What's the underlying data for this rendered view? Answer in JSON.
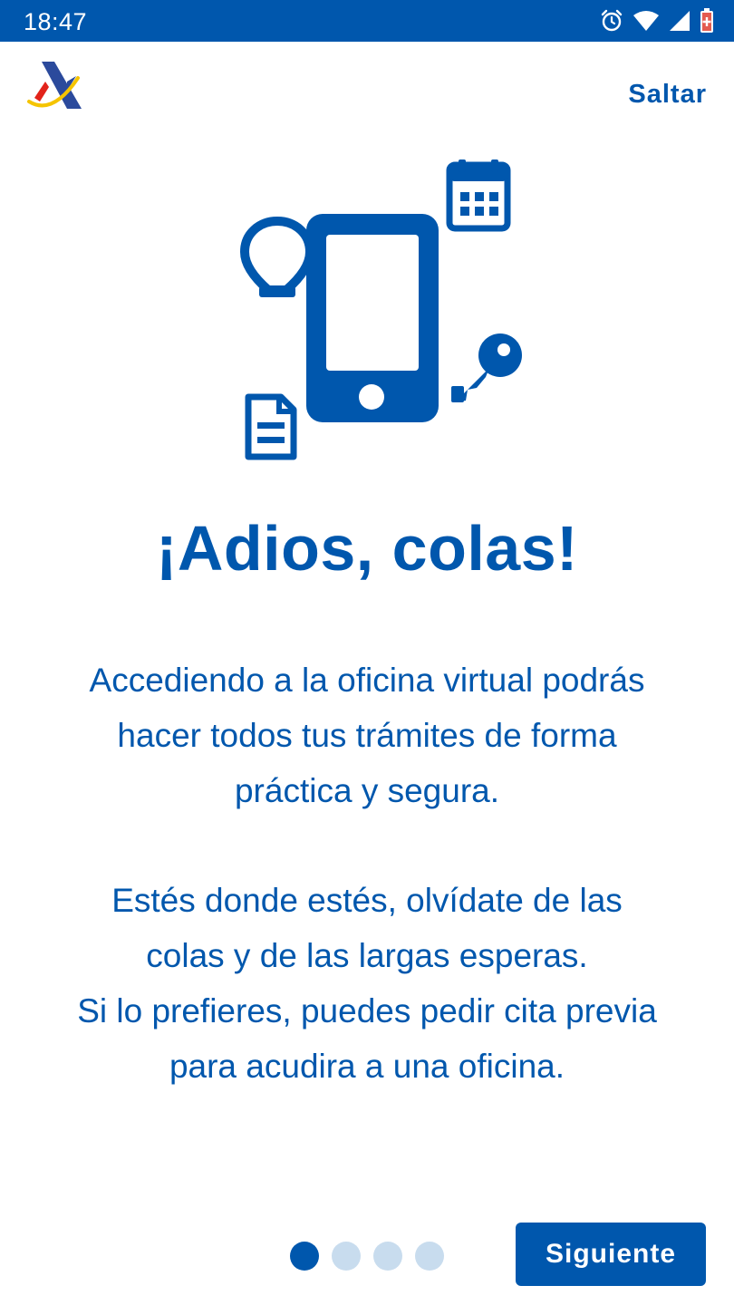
{
  "status_bar": {
    "time": "18:47",
    "icons": [
      "alarm-icon",
      "wifi-icon",
      "signal-icon",
      "battery-icon"
    ]
  },
  "header": {
    "logo": "aeat-logo",
    "skip_label": "Saltar"
  },
  "illustration": {
    "icons": [
      "phone-icon",
      "lightbulb-icon",
      "calendar-icon",
      "key-icon",
      "document-icon"
    ]
  },
  "main": {
    "title": "¡Adios, colas!",
    "paragraph1_lines": [
      "Accediendo a la oficina virtual podrás",
      "hacer todos tus trámites de forma",
      "práctica y segura."
    ],
    "paragraph2_lines": [
      "Estés donde estés, olvídate de las",
      "colas y de las largas esperas.",
      "Si lo prefieres, puedes pedir cita previa",
      "para acudira a una oficina."
    ]
  },
  "footer": {
    "pager": {
      "total": 4,
      "current": 1
    },
    "next_label": "Siguiente"
  },
  "colors": {
    "primary": "#0057ad",
    "dot_inactive": "#c8dcee",
    "logo_red": "#e2231a",
    "logo_yellow": "#f5c400"
  }
}
